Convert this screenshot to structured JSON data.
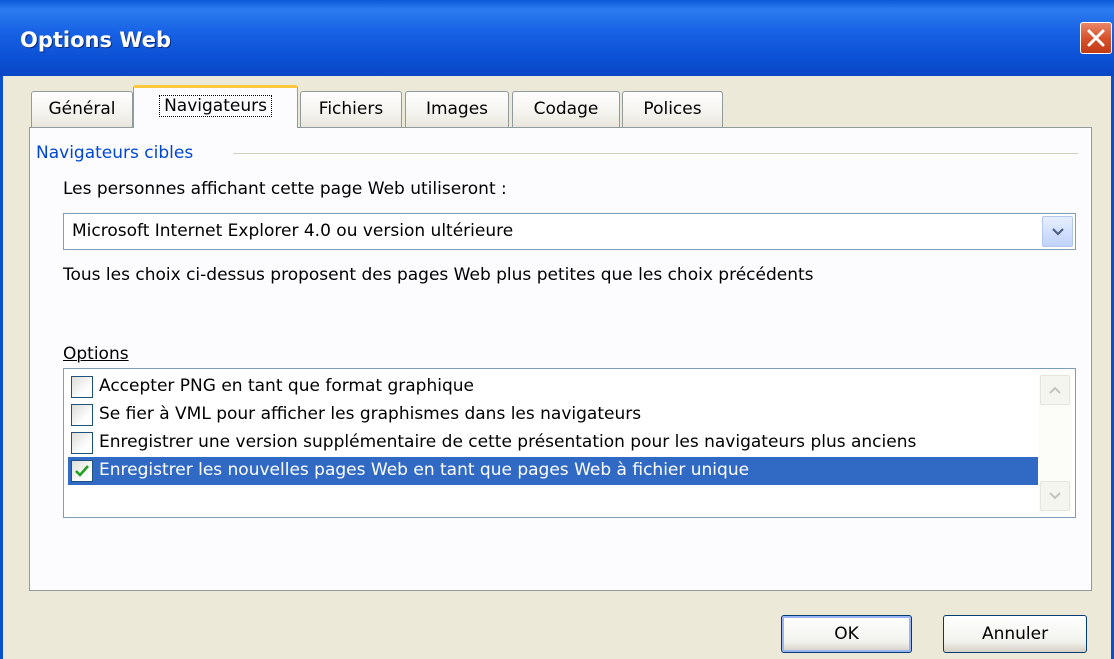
{
  "window": {
    "title": "Options Web"
  },
  "tabs": [
    {
      "label": "Général"
    },
    {
      "label": "Navigateurs",
      "active": true
    },
    {
      "label": "Fichiers"
    },
    {
      "label": "Images"
    },
    {
      "label": "Codage"
    },
    {
      "label": "Polices"
    }
  ],
  "group": {
    "title": "Navigateurs cibles",
    "prompt": "Les personnes affichant cette page Web utiliseront :",
    "select_value": "Microsoft Internet Explorer 4.0 ou version ultérieure",
    "note": "Tous les choix ci-dessus proposent des pages Web plus petites que les choix précédents"
  },
  "options": {
    "label": "Options",
    "items": [
      {
        "label": "Accepter PNG en tant que format graphique",
        "checked": false,
        "selected": false
      },
      {
        "label": "Se fier à VML pour afficher les graphismes dans les navigateurs",
        "checked": false,
        "selected": false
      },
      {
        "label": "Enregistrer une version supplémentaire de cette présentation pour les navigateurs plus anciens",
        "checked": false,
        "selected": false
      },
      {
        "label": "Enregistrer les nouvelles pages Web en tant que pages Web à fichier unique",
        "checked": true,
        "selected": true
      }
    ]
  },
  "buttons": {
    "ok": "OK",
    "cancel": "Annuler"
  },
  "colors": {
    "titlebar": "#0b4fd2",
    "selection": "#316ac5",
    "check": "#21a121",
    "group_label": "#0046d5"
  }
}
